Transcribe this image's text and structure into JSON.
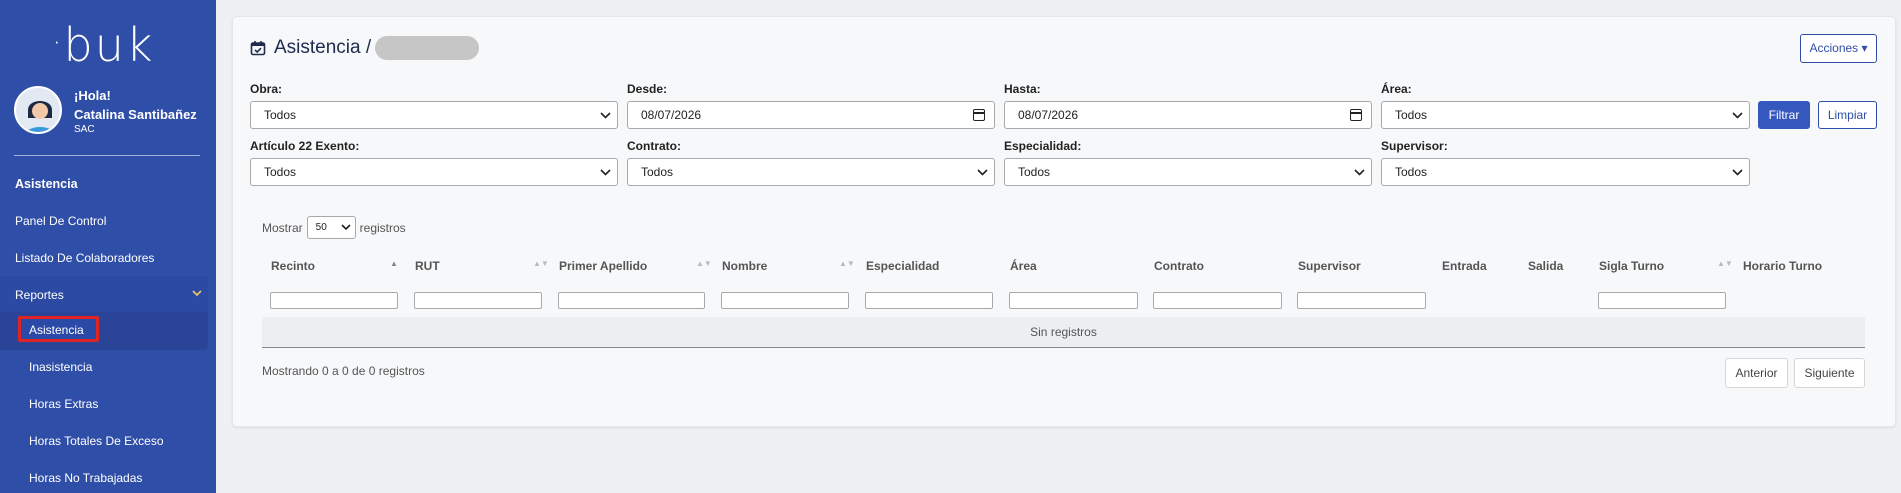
{
  "brand": {
    "logo_text": "buk",
    "logo_dot": "·"
  },
  "user": {
    "greeting": "¡Hola!",
    "name": "Catalina Santibañez",
    "role": "SAC"
  },
  "sidebar": {
    "section_title": "Asistencia",
    "items": [
      {
        "label": "Panel De Control"
      },
      {
        "label": "Listado De Colaboradores"
      },
      {
        "label": "Reportes"
      }
    ],
    "sub_items": [
      {
        "label": "Asistencia"
      },
      {
        "label": "Inasistencia"
      },
      {
        "label": "Horas Extras"
      },
      {
        "label": "Horas Totales De Exceso"
      },
      {
        "label": "Horas No Trabajadas"
      }
    ]
  },
  "header": {
    "title": "Asistencia /",
    "actions_label": "Acciones ▾"
  },
  "filters": {
    "obra": {
      "label": "Obra:",
      "value": "Todos"
    },
    "desde": {
      "label": "Desde:",
      "value": "08/07/2026"
    },
    "hasta": {
      "label": "Hasta:",
      "value": "08/07/2026"
    },
    "area": {
      "label": "Área:",
      "value": "Todos"
    },
    "articulo": {
      "label": "Artículo 22 Exento:",
      "value": "Todos"
    },
    "contrato": {
      "label": "Contrato:",
      "value": "Todos"
    },
    "especialidad": {
      "label": "Especialidad:",
      "value": "Todos"
    },
    "supervisor": {
      "label": "Supervisor:",
      "value": "Todos"
    },
    "filter_button": "Filtrar",
    "clear_button": "Limpiar"
  },
  "table": {
    "show_label": "Mostrar",
    "page_size": "50",
    "records_label": "registros",
    "columns": [
      "Recinto",
      "RUT",
      "Primer Apellido",
      "Nombre",
      "Especialidad",
      "Área",
      "Contrato",
      "Supervisor",
      "Entrada",
      "Salida",
      "Sigla Turno",
      "Horario Turno"
    ],
    "empty_text": "Sin registros",
    "info_text": "Mostrando 0 a 0 de 0 registros",
    "prev_label": "Anterior",
    "next_label": "Siguiente"
  },
  "colors": {
    "sidebar": "#2f4ea7",
    "primary": "#3558bf",
    "highlight": "#e02424"
  }
}
